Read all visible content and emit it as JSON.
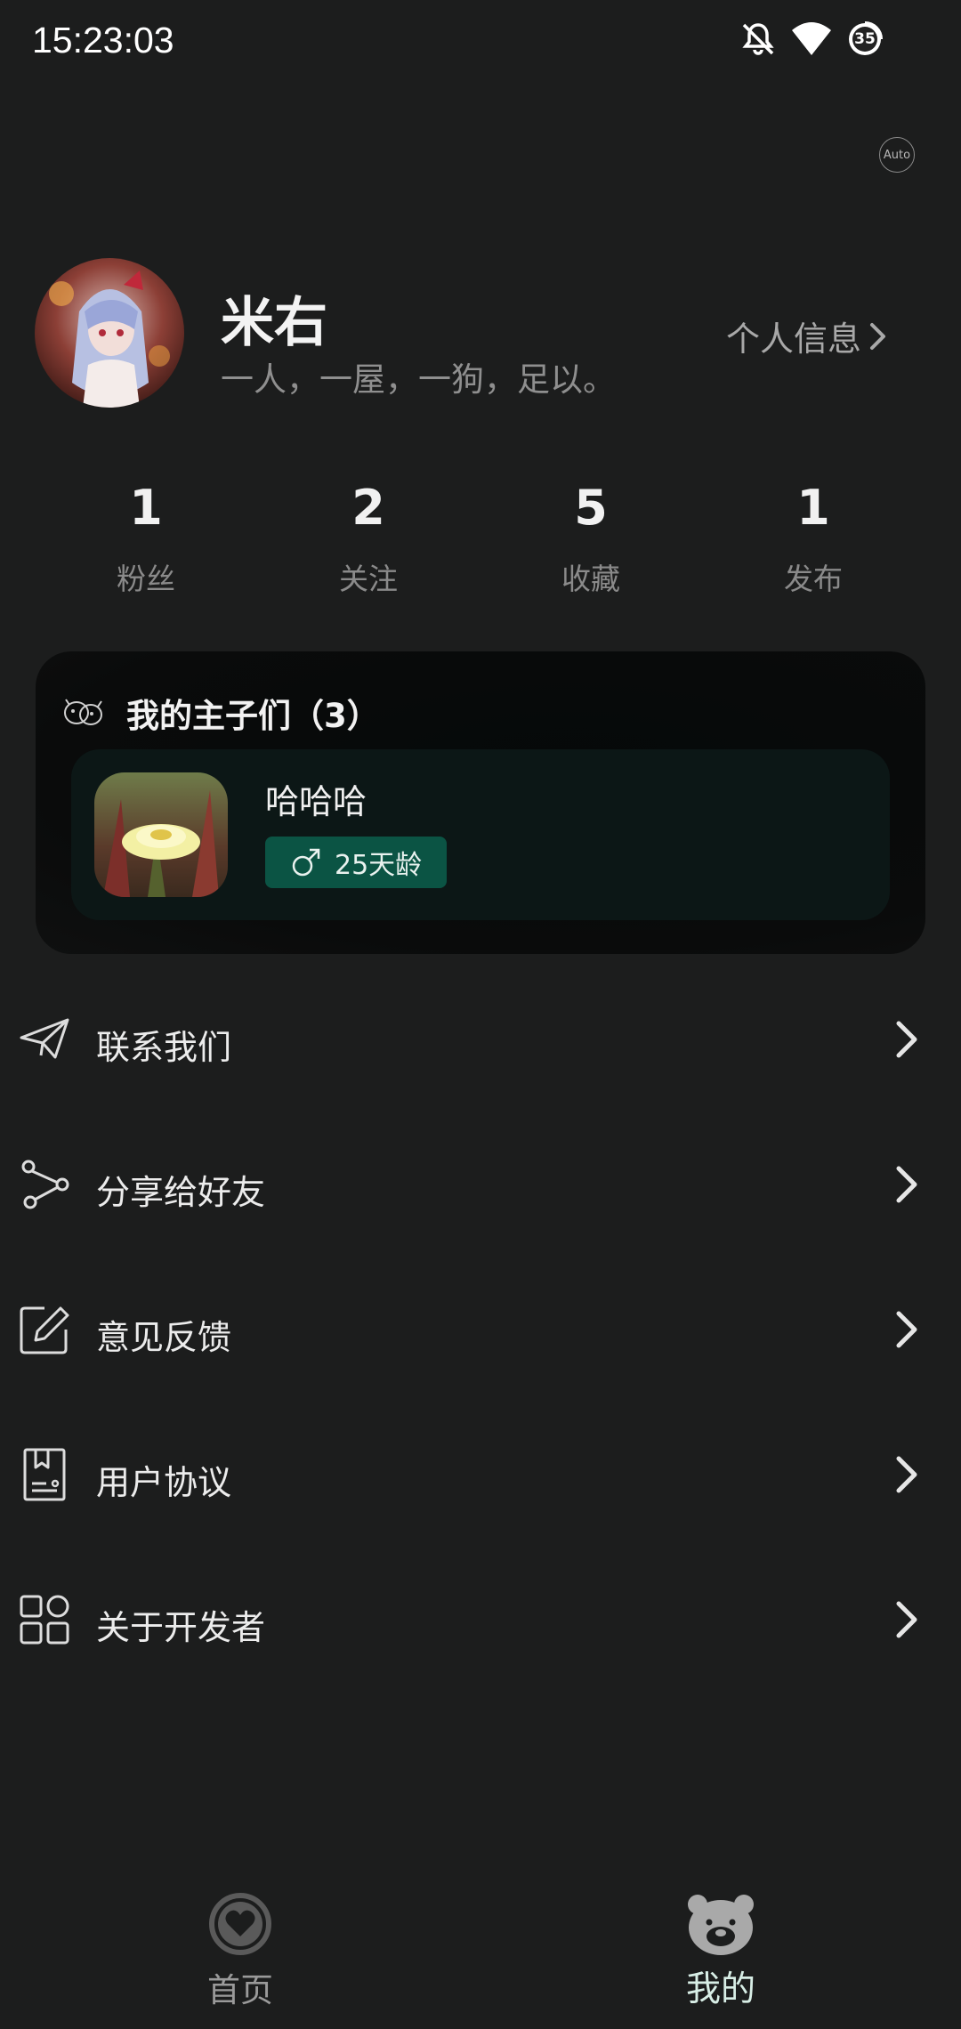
{
  "status_bar": {
    "time": "15:23:03",
    "battery": "35"
  },
  "theme_toggle": "Auto",
  "profile": {
    "name": "米右",
    "bio": "一人，一屋，一狗，足以。",
    "link_label": "个人信息"
  },
  "stats": [
    {
      "value": "1",
      "label": "粉丝"
    },
    {
      "value": "2",
      "label": "关注"
    },
    {
      "value": "5",
      "label": "收藏"
    },
    {
      "value": "1",
      "label": "发布"
    }
  ],
  "pets": {
    "title": "我的主子们（3）",
    "item": {
      "name": "哈哈哈",
      "age": "25天龄",
      "gender_icon": "male-icon"
    }
  },
  "menu": [
    {
      "label": "联系我们",
      "icon": "paper-plane-icon"
    },
    {
      "label": "分享给好友",
      "icon": "share-icon"
    },
    {
      "label": "意见反馈",
      "icon": "edit-icon"
    },
    {
      "label": "用户协议",
      "icon": "document-icon"
    },
    {
      "label": "关于开发者",
      "icon": "grid-icon"
    }
  ],
  "bottom_nav": {
    "home_label": "首页",
    "me_label": "我的"
  },
  "colors": {
    "background": "#1c1d1d",
    "badge": "#0b5444",
    "active_tab": "#d8eee6"
  }
}
